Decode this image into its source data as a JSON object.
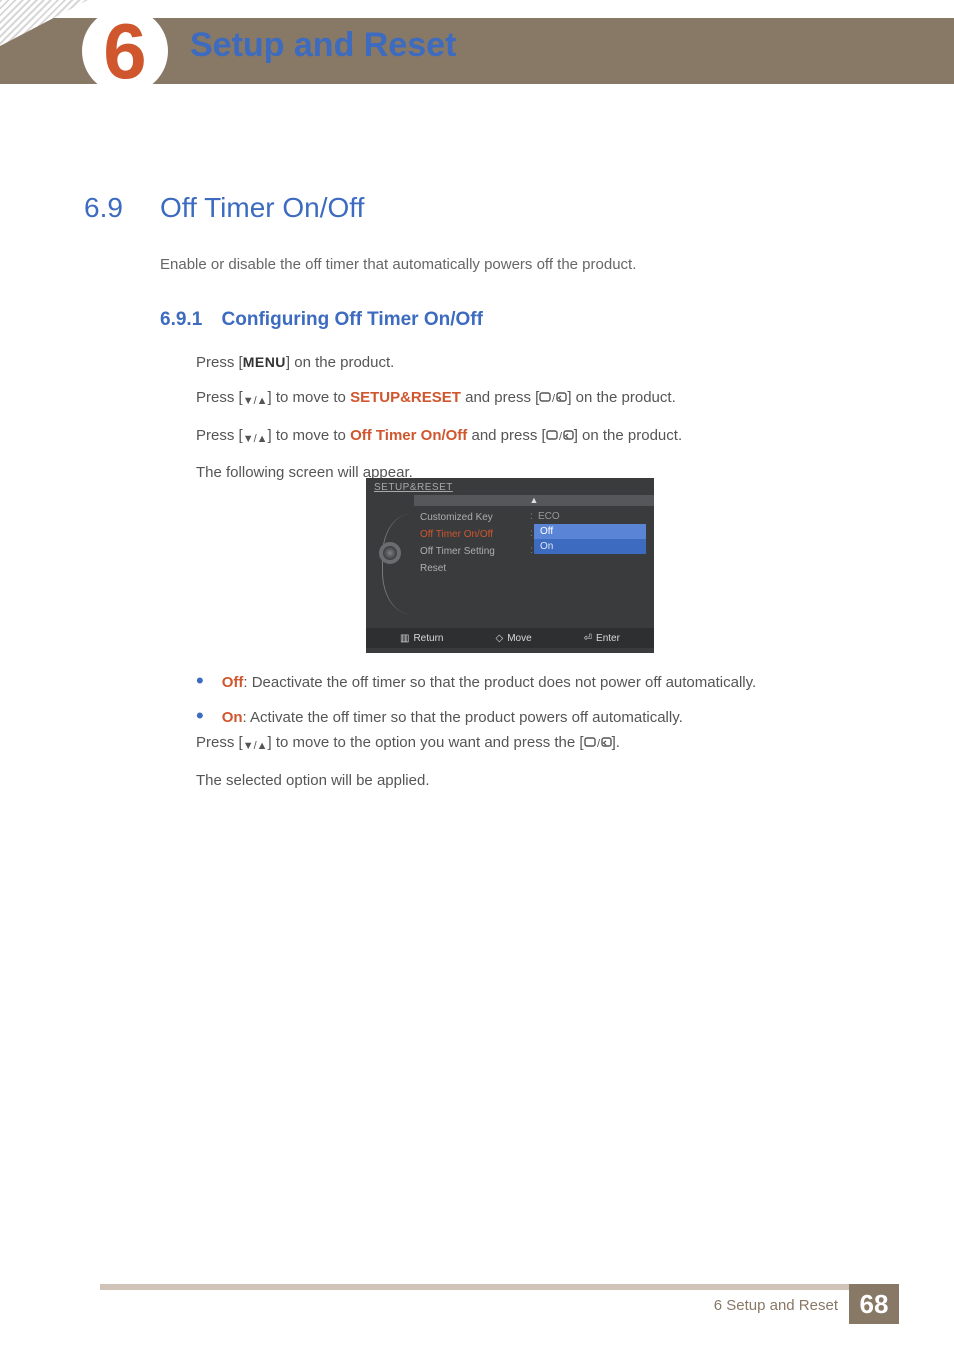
{
  "header": {
    "chapter_number": "6",
    "chapter_title": "Setup and Reset"
  },
  "section": {
    "number": "6.9",
    "title": "Off Timer On/Off",
    "intro": "Enable or disable the off timer that automatically powers off the product."
  },
  "subsection": {
    "number": "6.9.1",
    "title": "Configuring Off Timer On/Off"
  },
  "steps": {
    "s1_pre": "Press [",
    "s1_menu": "MENU",
    "s1_post": "] on the product.",
    "s2_pre": "Press [",
    "s2_mid": "] to move to ",
    "s2_target": "SETUP&RESET",
    "s2_post1": " and press [",
    "s2_post2": "] on the product.",
    "s3_pre": "Press [",
    "s3_mid": "] to move to ",
    "s3_target": "Off Timer On/Off",
    "s3_post1": " and press [",
    "s3_post2": "] on the product.",
    "s4": "The following screen will appear."
  },
  "osd": {
    "title": "SETUP&RESET",
    "items": [
      "Customized Key",
      "Off Timer On/Off",
      "Off Timer Setting",
      "Reset"
    ],
    "value0": "ECO",
    "dropdown": [
      "Off",
      "On"
    ],
    "footer": {
      "return": "Return",
      "move": "Move",
      "enter": "Enter"
    }
  },
  "options": {
    "off_label": "Off",
    "off_desc": ": Deactivate the off timer so that the product does not power off automatically.",
    "on_label": "On",
    "on_desc": ": Activate the off timer so that the product powers off automatically."
  },
  "post": {
    "p1_pre": "Press [",
    "p1_mid": "] to move to the option you want and press the [",
    "p1_post": "].",
    "p2": "The selected option will be applied."
  },
  "footer": {
    "label": "6 Setup and Reset",
    "page": "68"
  }
}
